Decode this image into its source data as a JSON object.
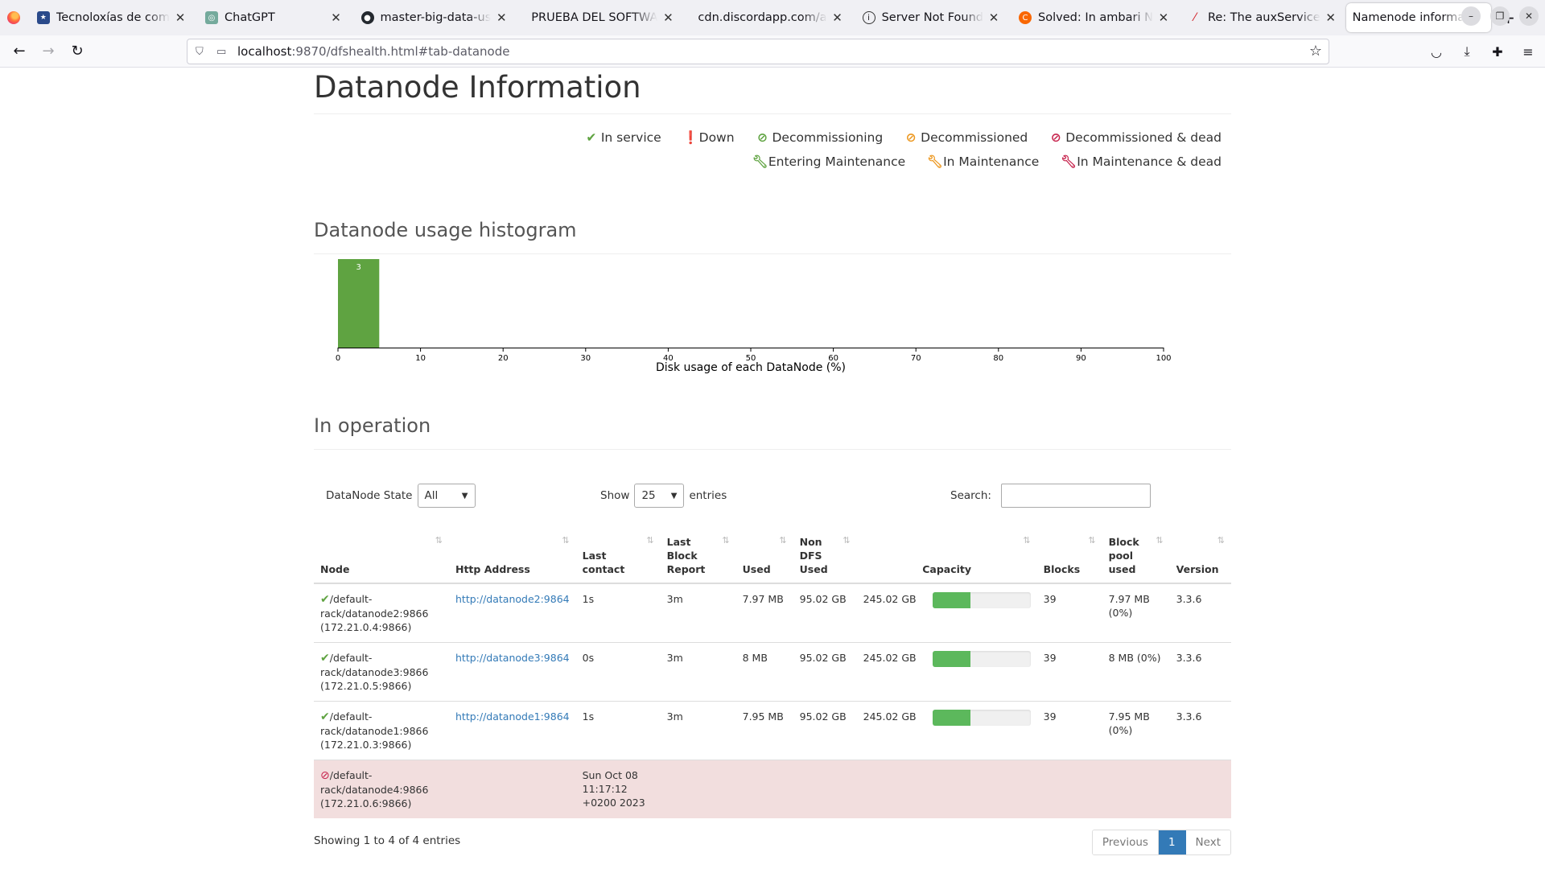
{
  "browser": {
    "tabs": [
      {
        "title": "Tecnoloxías de com",
        "favicon": "flag-icon",
        "active": false
      },
      {
        "title": "ChatGPT",
        "favicon": "chatgpt-icon",
        "active": false
      },
      {
        "title": "master-big-data-us",
        "favicon": "github-icon",
        "active": false
      },
      {
        "title": "PRUEBA DEL SOFTWA",
        "favicon": "",
        "active": false
      },
      {
        "title": "cdn.discordapp.com/a",
        "favicon": "",
        "active": false
      },
      {
        "title": "Server Not Found",
        "favicon": "info-icon",
        "active": false
      },
      {
        "title": "Solved: In ambari N",
        "favicon": "cloudera-icon",
        "active": false
      },
      {
        "title": "Re: The auxService",
        "favicon": "feather-icon",
        "active": false
      },
      {
        "title": "Namenode informatio",
        "favicon": "",
        "active": true
      }
    ],
    "url_host": "localhost",
    "url_path": ":9870/dfshealth.html#tab-datanode"
  },
  "page": {
    "title": "Datanode Information",
    "legend": [
      {
        "label": "In service",
        "icon": "check-icon",
        "color": "#5fa341"
      },
      {
        "label": "Down",
        "icon": "exclamation-circle-icon",
        "color": "#c7254e"
      },
      {
        "label": "Decommissioning",
        "icon": "ban-icon",
        "color": "#5fa341"
      },
      {
        "label": "Decommissioned",
        "icon": "ban-icon",
        "color": "#ec971f"
      },
      {
        "label": "Decommissioned & dead",
        "icon": "ban-icon",
        "color": "#c7254e"
      },
      {
        "label": "Entering Maintenance",
        "icon": "wrench-icon",
        "color": "#5fa341"
      },
      {
        "label": "In Maintenance",
        "icon": "wrench-icon",
        "color": "#ec971f"
      },
      {
        "label": "In Maintenance & dead",
        "icon": "wrench-icon",
        "color": "#c7254e"
      }
    ],
    "histogram_title": "Datanode usage histogram",
    "operation_title": "In operation"
  },
  "chart_data": {
    "type": "bar",
    "bins": [
      [
        0,
        5
      ]
    ],
    "values": [
      3
    ],
    "data_labels": [
      "3"
    ],
    "xlim": [
      0,
      100
    ],
    "xticks": [
      "0",
      "10",
      "20",
      "30",
      "40",
      "50",
      "60",
      "70",
      "80",
      "90",
      "100"
    ],
    "xlabel": "Disk usage of each DataNode (%)",
    "bar_color": "#5fa341"
  },
  "controls": {
    "state_label": "DataNode State",
    "state_value": "All",
    "show_label": "Show",
    "show_value": "25",
    "entries_label": "entries",
    "search_label": "Search:"
  },
  "table": {
    "headers": [
      "Node",
      "Http Address",
      "Last contact",
      "Last Block Report",
      "Used",
      "Non DFS Used",
      "Capacity",
      "Blocks",
      "Block pool used",
      "Version"
    ],
    "rows": [
      {
        "node": "/default-rack/datanode2:9866 (172.21.0.4:9866)",
        "http": "http://datanode2:9864",
        "last_contact": "1s",
        "last_block_report": "3m",
        "used": "7.97 MB",
        "non_dfs": "95.02 GB",
        "capacity": "245.02 GB",
        "capacity_pct": 39,
        "blocks": "39",
        "pool_used": "7.97 MB (0%)",
        "version": "3.3.6"
      },
      {
        "node": "/default-rack/datanode3:9866 (172.21.0.5:9866)",
        "http": "http://datanode3:9864",
        "last_contact": "0s",
        "last_block_report": "3m",
        "used": "8 MB",
        "non_dfs": "95.02 GB",
        "capacity": "245.02 GB",
        "capacity_pct": 39,
        "blocks": "39",
        "pool_used": "8 MB (0%)",
        "version": "3.3.6"
      },
      {
        "node": "/default-rack/datanode1:9866 (172.21.0.3:9866)",
        "http": "http://datanode1:9864",
        "last_contact": "1s",
        "last_block_report": "3m",
        "used": "7.95 MB",
        "non_dfs": "95.02 GB",
        "capacity": "245.02 GB",
        "capacity_pct": 39,
        "blocks": "39",
        "pool_used": "7.95 MB (0%)",
        "version": "3.3.6"
      },
      {
        "node": "/default-rack/datanode4:9866 (172.21.0.6:9866)",
        "last_contact": "Sun Oct 08 11:17:12 +0200 2023"
      }
    ]
  },
  "footer": {
    "info": "Showing 1 to 4 of 4 entries",
    "prev": "Previous",
    "page": "1",
    "next": "Next"
  }
}
